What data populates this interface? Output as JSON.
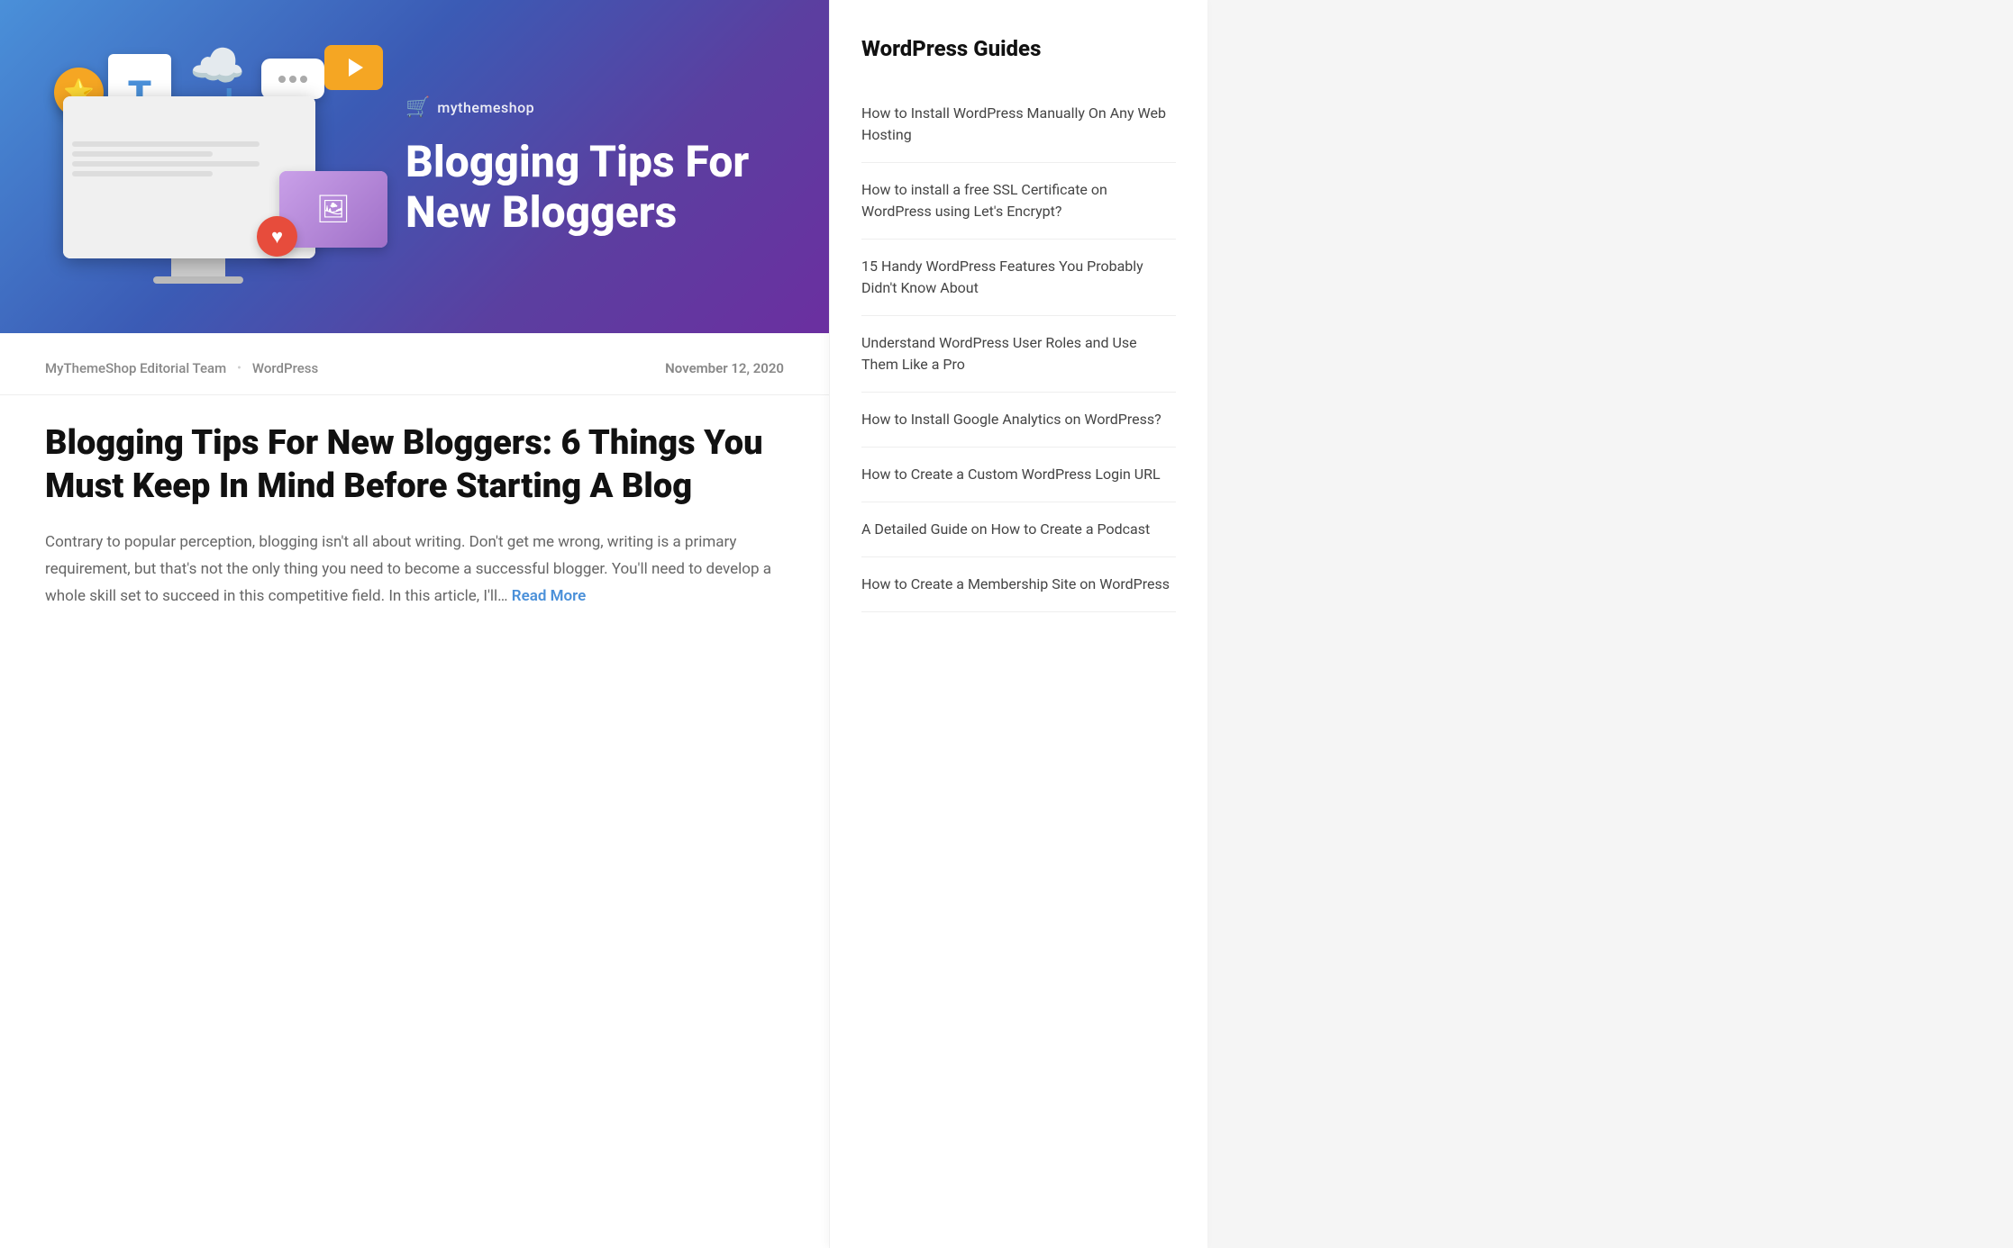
{
  "hero": {
    "brand_icon": "🛒",
    "brand_name": "mythemeshop",
    "title": "Blogging Tips For New Bloggers"
  },
  "article": {
    "author": "MyThemeShop Editorial Team",
    "category": "WordPress",
    "date": "November 12, 2020",
    "title": "Blogging Tips For New Bloggers: 6 Things You Must Keep In Mind Before Starting A Blog",
    "excerpt": "Contrary to popular perception, blogging isn't all about writing. Don't get me wrong, writing is a primary requirement, but that's not the only thing you need to become a successful blogger. You'll need to develop a whole skill set to succeed in this competitive field. In this article, I'll…",
    "read_more": "Read More"
  },
  "sidebar": {
    "title": "WordPress Guides",
    "items": [
      {
        "label": "How to Install WordPress Manually On Any Web Hosting"
      },
      {
        "label": "How to install a free SSL Certificate on WordPress using Let's Encrypt?"
      },
      {
        "label": "15 Handy WordPress Features You Probably Didn't Know About"
      },
      {
        "label": "Understand WordPress User Roles and Use Them Like a Pro"
      },
      {
        "label": "How to Install Google Analytics on WordPress?"
      },
      {
        "label": "How to Create a Custom WordPress Login URL"
      },
      {
        "label": "A Detailed Guide on How to Create a Podcast"
      },
      {
        "label": "How to Create a Membership Site on WordPress"
      }
    ]
  }
}
